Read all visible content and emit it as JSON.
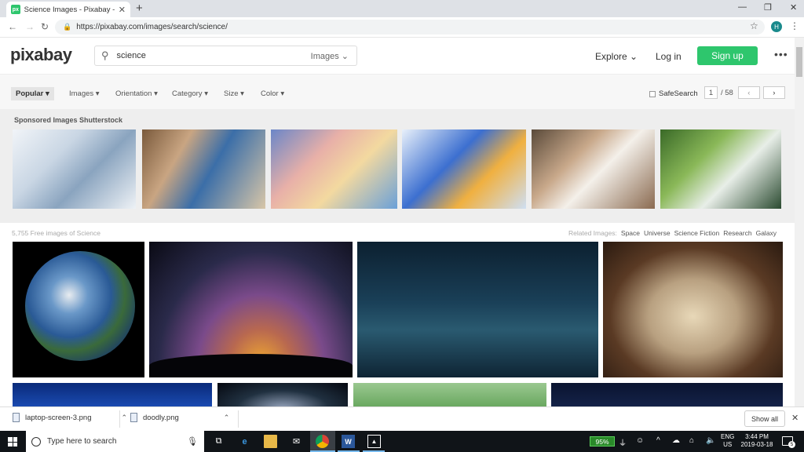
{
  "browser": {
    "tab_title": "Science Images - Pixabay - Down",
    "favicon_text": "px",
    "url": "https://pixabay.com/images/search/science/",
    "profile_initial": "H"
  },
  "header": {
    "logo": "pixabay",
    "search_value": "science",
    "search_type": "Images",
    "explore": "Explore",
    "login": "Log in",
    "signup": "Sign up"
  },
  "filters": {
    "items": [
      "Popular",
      "Images",
      "Orientation",
      "Category",
      "Size",
      "Color"
    ],
    "safesearch": "SafeSearch",
    "page_current": "1",
    "page_total": "/ 58"
  },
  "sponsored": {
    "label": "Sponsored Images Shutterstock"
  },
  "results": {
    "count_text": "5,755 Free images of Science",
    "related_label": "Related Images:",
    "related_tags": [
      "Space",
      "Universe",
      "Science Fiction",
      "Research",
      "Galaxy"
    ]
  },
  "downloads": {
    "items": [
      "laptop-screen-3.png",
      "doodly.png"
    ],
    "show_all": "Show all"
  },
  "taskbar": {
    "search_placeholder": "Type here to search",
    "battery": "95%",
    "lang_line1": "ENG",
    "lang_line2": "US",
    "time": "3:44 PM",
    "date": "2019-03-18",
    "notifications": "5"
  },
  "colors": {
    "brand_green": "#2ec66d",
    "taskbar": "#101418"
  }
}
